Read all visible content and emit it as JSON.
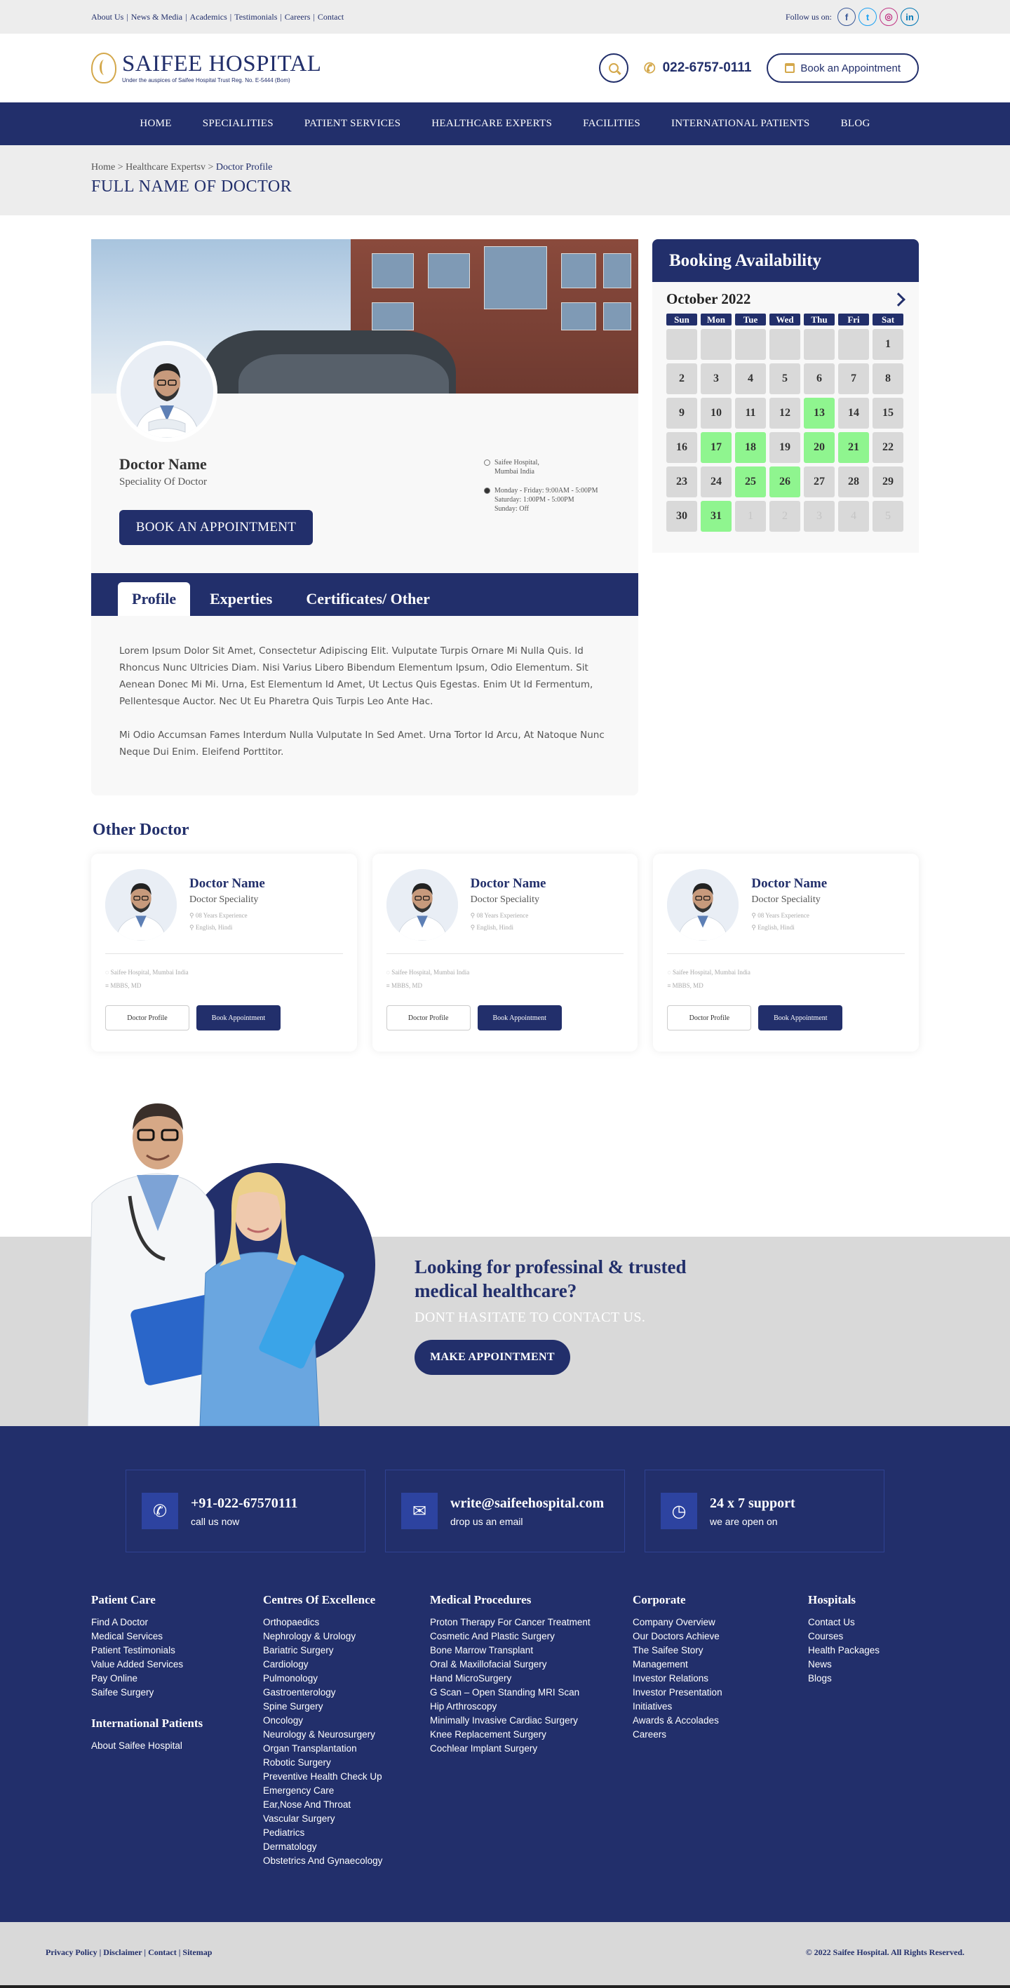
{
  "topbar": {
    "links": [
      "About Us",
      "News & Media",
      "Academics",
      "Testimonials",
      "Careers",
      "Contact"
    ],
    "follow_label": "Follow us on:",
    "social": [
      {
        "icon": "facebook-icon",
        "glyph": "f",
        "color": "#3b5998"
      },
      {
        "icon": "twitter-icon",
        "glyph": "t",
        "color": "#1da1f2"
      },
      {
        "icon": "instagram-icon",
        "glyph": "◎",
        "color": "#c13584"
      },
      {
        "icon": "linkedin-icon",
        "glyph": "in",
        "color": "#0077b5"
      }
    ]
  },
  "header": {
    "logo_title": "SAIFEE HOSPITAL",
    "logo_sub": "Under the auspices of Saifee Hospital Trust Reg. No. E-5444 (Bom)",
    "phone": "022-6757-0111",
    "book_label": "Book an Appointment"
  },
  "nav": [
    "HOME",
    "SPECIALITIES",
    "PATIENT SERVICES",
    "HEALTHCARE EXPERTS",
    "FACILITIES",
    "INTERNATIONAL PATIENTS",
    "BLOG"
  ],
  "breadcrumb": {
    "home": "Home",
    "mid": "> Healthcare Expertsv >",
    "current": "Doctor Profile",
    "title": "FULL NAME OF DOCTOR"
  },
  "profile": {
    "name": "Doctor Name",
    "speciality": "Speciality Of Doctor",
    "book_btn": "BOOK AN APPOINTMENT",
    "location_line1": "Saifee Hospital,",
    "location_line2": "Mumbai India",
    "hours_line1": "Monday - Friday: 9:00AM - 5:00PM",
    "hours_line2": "Saturday: 1:00PM - 5:00PM",
    "hours_line3": "Sunday: Off",
    "tabs": [
      "Profile",
      "Experties",
      "Certificates/ Other"
    ],
    "para1": "Lorem Ipsum Dolor Sit Amet, Consectetur Adipiscing Elit. Vulputate Turpis Ornare Mi Nulla Quis. Id Rhoncus Nunc Ultricies Diam. Nisi Varius Libero Bibendum Elementum Ipsum, Odio Elementum. Sit Aenean Donec Mi Mi. Urna, Est Elementum Id Amet, Ut Lectus Quis Egestas. Enim Ut Id Fermentum, Pellentesque Auctor. Nec Ut Eu Pharetra Quis Turpis Leo Ante Hac.",
    "para2": "Mi Odio Accumsan Fames Interdum Nulla Vulputate In Sed Amet. Urna Tortor Id Arcu, At Natoque Nunc Neque Dui Enim. Eleifend Porttitor."
  },
  "booking": {
    "title": "Booking Availability",
    "month": "October 2022",
    "weekdays": [
      "Sun",
      "Mon",
      "Tue",
      "Wed",
      "Thu",
      "Fri",
      "Sat"
    ],
    "days": [
      {
        "d": "",
        "s": "empty"
      },
      {
        "d": "",
        "s": "empty"
      },
      {
        "d": "",
        "s": "empty"
      },
      {
        "d": "",
        "s": "empty"
      },
      {
        "d": "",
        "s": "empty"
      },
      {
        "d": "",
        "s": "empty"
      },
      {
        "d": "1",
        "s": "normal"
      },
      {
        "d": "2",
        "s": "normal"
      },
      {
        "d": "3",
        "s": "normal"
      },
      {
        "d": "4",
        "s": "normal"
      },
      {
        "d": "5",
        "s": "normal"
      },
      {
        "d": "6",
        "s": "normal"
      },
      {
        "d": "7",
        "s": "normal"
      },
      {
        "d": "8",
        "s": "normal"
      },
      {
        "d": "9",
        "s": "normal"
      },
      {
        "d": "10",
        "s": "normal"
      },
      {
        "d": "11",
        "s": "normal"
      },
      {
        "d": "12",
        "s": "normal"
      },
      {
        "d": "13",
        "s": "avail"
      },
      {
        "d": "14",
        "s": "normal"
      },
      {
        "d": "15",
        "s": "normal"
      },
      {
        "d": "16",
        "s": "normal"
      },
      {
        "d": "17",
        "s": "avail"
      },
      {
        "d": "18",
        "s": "avail"
      },
      {
        "d": "19",
        "s": "normal"
      },
      {
        "d": "20",
        "s": "avail"
      },
      {
        "d": "21",
        "s": "avail"
      },
      {
        "d": "22",
        "s": "normal"
      },
      {
        "d": "23",
        "s": "normal"
      },
      {
        "d": "24",
        "s": "normal"
      },
      {
        "d": "25",
        "s": "avail"
      },
      {
        "d": "26",
        "s": "avail"
      },
      {
        "d": "27",
        "s": "normal"
      },
      {
        "d": "28",
        "s": "normal"
      },
      {
        "d": "29",
        "s": "normal"
      },
      {
        "d": "30",
        "s": "normal"
      },
      {
        "d": "31",
        "s": "avail"
      },
      {
        "d": "1",
        "s": "muted"
      },
      {
        "d": "2",
        "s": "muted"
      },
      {
        "d": "3",
        "s": "muted"
      },
      {
        "d": "4",
        "s": "muted"
      },
      {
        "d": "5",
        "s": "muted"
      }
    ]
  },
  "other": {
    "title": "Other Doctor",
    "cards": [
      {
        "name": "Doctor Name",
        "speciality": "Doctor Speciality",
        "experience": "08 Years Experience",
        "languages": "English, Hindi",
        "location": "Saifee Hospital, Mumbai India",
        "degree": "MBBS, MD",
        "profile_btn": "Doctor Profile",
        "book_btn": "Book Appointment"
      },
      {
        "name": "Doctor Name",
        "speciality": "Doctor Speciality",
        "experience": "08 Years Experience",
        "languages": "English, Hindi",
        "location": "Saifee Hospital, Mumbai India",
        "degree": "MBBS, MD",
        "profile_btn": "Doctor Profile",
        "book_btn": "Book Appointment"
      },
      {
        "name": "Doctor Name",
        "speciality": "Doctor Speciality",
        "experience": "08 Years Experience",
        "languages": "English, Hindi",
        "location": "Saifee Hospital, Mumbai India",
        "degree": "MBBS, MD",
        "profile_btn": "Doctor Profile",
        "book_btn": "Book Appointment"
      }
    ]
  },
  "cta": {
    "heading": "Looking for professinal & trusted medical healthcare?",
    "sub": "DONT HASITATE TO CONTACT US.",
    "button": "MAKE APPOINTMENT"
  },
  "footer": {
    "contacts": [
      {
        "icon": "phone-icon",
        "glyph": "✆",
        "title": "+91-022-67570111",
        "sub": "call us now"
      },
      {
        "icon": "mail-icon",
        "glyph": "✉",
        "title": "write@saifeehospital.com",
        "sub": "drop us an email"
      },
      {
        "icon": "clock-icon",
        "glyph": "◷",
        "title": "24 x 7 support",
        "sub": "we are open on"
      }
    ],
    "patient_care": {
      "title": "Patient Care",
      "items": [
        "Find A Doctor",
        "Medical Services",
        "Patient Testimonials",
        "Value Added Services",
        "Pay Online",
        "Saifee Surgery"
      ]
    },
    "international": {
      "title": "International Patients",
      "items": [
        "About Saifee Hospital"
      ]
    },
    "centres": {
      "title": "Centres Of Excellence",
      "items": [
        "Orthopaedics",
        "Nephrology & Urology",
        "Bariatric Surgery",
        "Cardiology",
        "Pulmonology",
        "Gastroenterology",
        "Spine Surgery",
        "Oncology",
        "Neurology & Neurosurgery",
        "Organ Transplantation",
        "Robotic Surgery",
        "Preventive Health Check Up",
        "Emergency Care",
        "Ear,Nose And Throat",
        "Vascular Surgery",
        "Pediatrics",
        "Dermatology",
        "Obstetrics And Gynaecology"
      ]
    },
    "procedures": {
      "title": "Medical Procedures",
      "items": [
        "Proton Therapy For Cancer Treatment",
        "Cosmetic And Plastic Surgery",
        "Bone Marrow Transplant",
        "Oral & Maxillofacial Surgery",
        "Hand MicroSurgery",
        "G Scan – Open Standing MRI Scan",
        "Hip Arthroscopy",
        "Minimally Invasive Cardiac Surgery",
        "Knee Replacement Surgery",
        "Cochlear Implant Surgery"
      ]
    },
    "corporate": {
      "title": "Corporate",
      "items": [
        "Company Overview",
        "Our Doctors Achieve",
        "The Saifee Story",
        "Management",
        "Investor Relations",
        "Investor Presentation",
        "Initiatives",
        "Awards & Accolades",
        "Careers"
      ]
    },
    "hospitals": {
      "title": "Hospitals",
      "items": [
        "Contact Us",
        "Courses",
        "Health Packages",
        "News",
        "Blogs"
      ]
    }
  },
  "bottom": {
    "links": [
      "Privacy Policy",
      "Disclaimer",
      "Contact",
      "Sitemap"
    ],
    "copyright": "© 2022 Saifee Hospital. All Rights Reserved."
  }
}
